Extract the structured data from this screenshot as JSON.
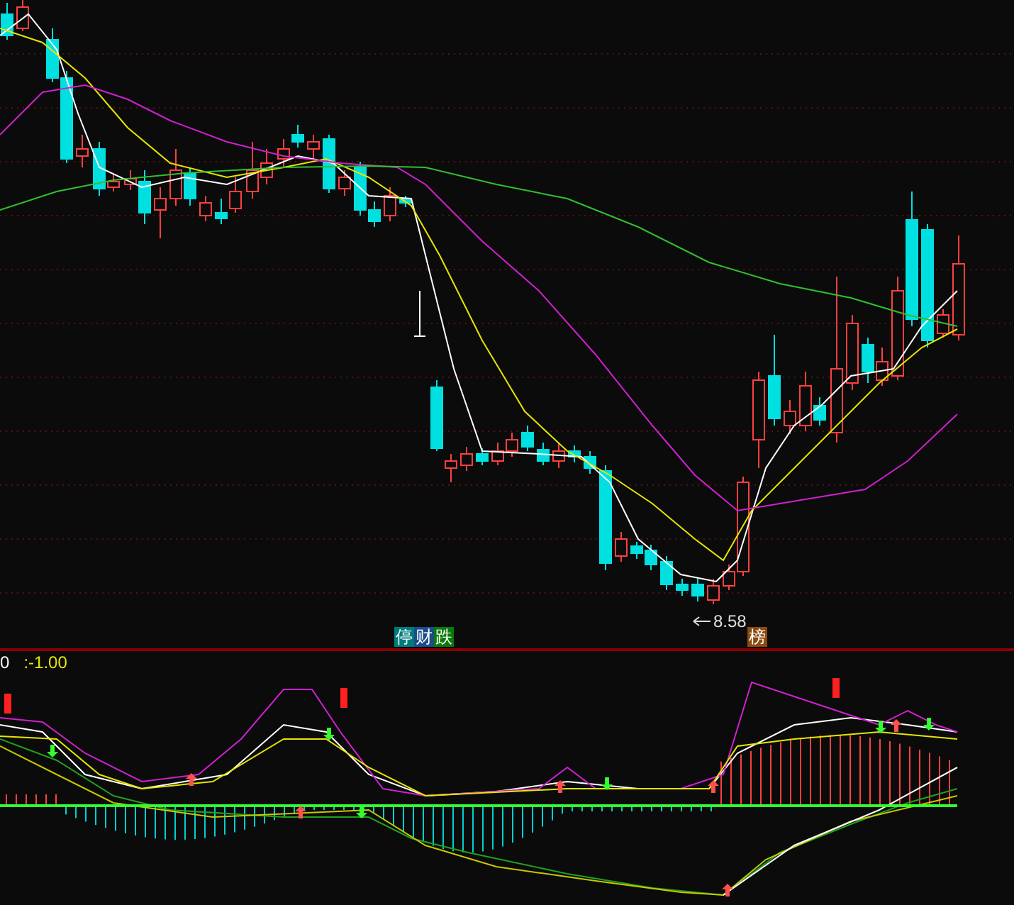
{
  "price_chart": {
    "low_price_label": "8.58",
    "event_badges": [
      {
        "text": "停",
        "color": "#007b7b"
      },
      {
        "text": "财",
        "color": "#1a4d8a"
      },
      {
        "text": "跌",
        "color": "#0a7a0a"
      }
    ],
    "rank_badges": [
      {
        "text": "榜",
        "color": "#8a4a10"
      }
    ]
  },
  "indicator": {
    "name": "0",
    "value": ":-1.00"
  }
}
